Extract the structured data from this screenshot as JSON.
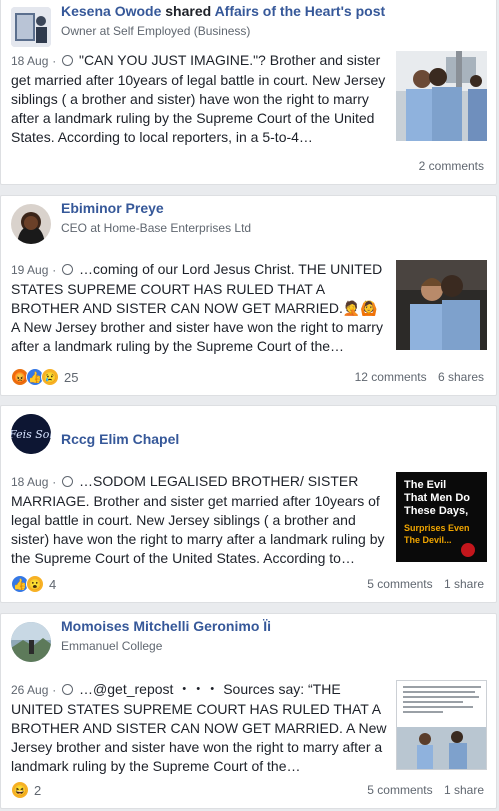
{
  "posts": [
    {
      "author": "Kesena Owode",
      "shared_word": "shared",
      "shared_from": "Affairs of the Heart's post",
      "subtitle": "Owner at Self Employed (Business)",
      "date": "18 Aug",
      "text": "\"CAN YOU JUST IMAGINE.\"? Brother and sister get married after 10years of legal battle in court. New Jersey siblings ( a brother and sister) have won the right to marry after a landmark ruling by the Supreme Court of the United States. According to local reporters, in a 5-to-4…",
      "reaction_icons": [],
      "reaction_count": "",
      "comments": "2 comments",
      "shares": ""
    },
    {
      "author": "Ebiminor Preye",
      "subtitle": "CEO at Home-Base Enterprises Ltd",
      "date": "19 Aug",
      "text": "…coming of our Lord Jesus Christ. THE UNITED STATES SUPREME COURT HAS RULED THAT A BROTHER AND SISTER CAN NOW GET MARRIED.🤦🙆 A New Jersey brother and sister have won the right to marry after a landmark ruling by the Supreme Court of the…",
      "reaction_icons": [
        "angry-reaction-icon",
        "like-reaction-icon",
        "sad-reaction-icon"
      ],
      "reaction_count": "25",
      "comments": "12 comments",
      "shares": "6 shares"
    },
    {
      "author": "Rccg Elim Chapel",
      "subtitle": "",
      "date": "18 Aug",
      "text": "…SODOM LEGALISED BROTHER/ SISTER MARRIAGE. Brother and sister get married after 10years of legal battle in court. New Jersey siblings ( a brother and sister) have won the right to marry after a landmark ruling by the Supreme Court of the United States. According to…",
      "reaction_icons": [
        "like-reaction-icon",
        "wow-reaction-icon"
      ],
      "reaction_count": "4",
      "comments": "5 comments",
      "shares": "1 share",
      "thumb_text": {
        "line1": "The Evil",
        "line2": "That Men Do",
        "line3": "These Days,",
        "line4": "Surprises Even",
        "line5": "The Devil..."
      }
    },
    {
      "author": "Momoises Mitchelli Geronimo Ïi",
      "subtitle": "Emmanuel College",
      "date": "26 Aug",
      "text": "…@get_repost ・・・ Sources say: “THE UNITED STATES SUPREME COURT HAS RULED THAT A BROTHER AND SISTER CAN NOW GET MARRIED. A New Jersey brother and sister have won the right to marry after a landmark ruling by the Supreme Court of the…",
      "reaction_icons": [
        "haha-reaction-icon"
      ],
      "reaction_count": "2",
      "comments": "5 comments",
      "shares": "1 share"
    }
  ]
}
